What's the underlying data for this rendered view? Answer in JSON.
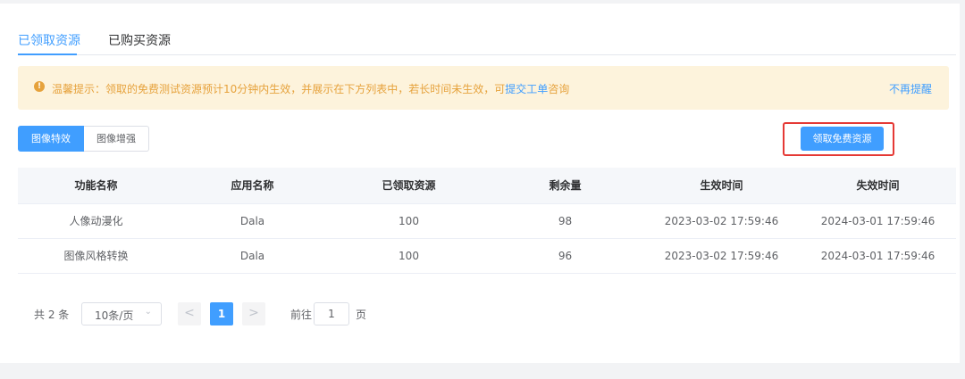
{
  "tabs": [
    {
      "label": "已领取资源"
    },
    {
      "label": "已购买资源"
    }
  ],
  "alert": {
    "prefix": "温馨提示：领取的免费测试资源预计10分钟内生效，并展示在下方列表中，若长时间未生效，可",
    "link": "提交工单",
    "suffix": "咨询",
    "dismiss": "不再提醒",
    "icon": "!"
  },
  "segment": {
    "options": [
      {
        "label": "图像特效"
      },
      {
        "label": "图像增强"
      }
    ]
  },
  "claim_button": "领取免费资源",
  "table": {
    "headers": [
      "功能名称",
      "应用名称",
      "已领取资源",
      "剩余量",
      "生效时间",
      "失效时间"
    ],
    "rows": [
      [
        "人像动漫化",
        "Dala",
        "100",
        "98",
        "2023-03-02 17:59:46",
        "2024-03-01 17:59:46"
      ],
      [
        "图像风格转换",
        "Dala",
        "100",
        "96",
        "2023-03-02 17:59:46",
        "2024-03-01 17:59:46"
      ]
    ]
  },
  "pagination": {
    "total": "共 2 条",
    "page_size": "10条/页",
    "prev": "<",
    "current": "1",
    "next": ">",
    "goto_label": "前往",
    "goto_value": "1",
    "page_label": "页"
  },
  "colors": {
    "accent": "#409eff",
    "warning": "#e6a23c",
    "highlight_border": "#e53935"
  }
}
